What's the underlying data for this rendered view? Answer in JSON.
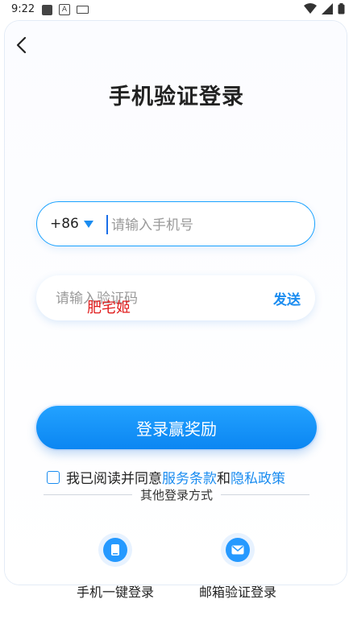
{
  "status_bar": {
    "time": "9:22",
    "a_badge": "A"
  },
  "header": {
    "title": "手机验证登录"
  },
  "phone": {
    "country_code": "+86",
    "placeholder": "请输入手机号"
  },
  "code": {
    "placeholder": "请输入验证码",
    "send_label": "发送"
  },
  "overlay": {
    "text": "肥宅姬"
  },
  "login_button": {
    "label": "登录赢奖励"
  },
  "agreement": {
    "prefix": "我已阅读并同意",
    "terms": "服务条款",
    "and": "和",
    "privacy": "隐私政策"
  },
  "other_login": {
    "title": "其他登录方式",
    "options": [
      {
        "label": "手机一键登录",
        "icon": "phone-icon"
      },
      {
        "label": "邮箱验证登录",
        "icon": "mail-icon"
      }
    ]
  },
  "colors": {
    "accent": "#1a8cf0",
    "button": "#0b86f2",
    "overlay": "#e01b1b"
  }
}
